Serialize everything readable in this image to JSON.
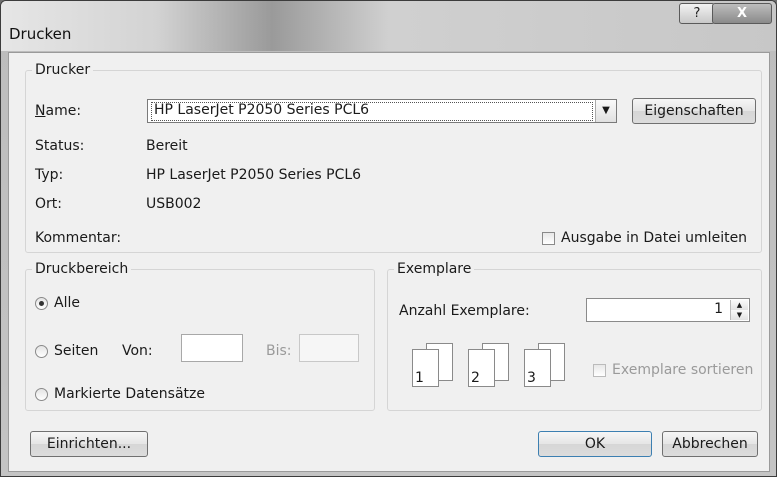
{
  "window": {
    "title": "Drucken",
    "help_label": "?",
    "close_label": "X"
  },
  "printer": {
    "legend": "Drucker",
    "name_label": "Name:",
    "name_value": "HP LaserJet P2050 Series PCL6",
    "properties_button": "Eigenschaften",
    "status_label": "Status:",
    "status_value": "Bereit",
    "type_label": "Typ:",
    "type_value": "HP LaserJet P2050 Series PCL6",
    "location_label": "Ort:",
    "location_value": "USB002",
    "comment_label": "Kommentar:",
    "print_to_file_label": "Ausgabe in Datei umleiten",
    "print_to_file_checked": false
  },
  "range": {
    "legend": "Druckbereich",
    "all_label": "Alle",
    "pages_label": "Seiten",
    "from_label": "Von:",
    "to_label": "Bis:",
    "selection_label": "Markierte Datensätze",
    "selected": "all"
  },
  "copies": {
    "legend": "Exemplare",
    "count_label": "Anzahl Exemplare:",
    "count_value": "1",
    "collate_label": "Exemplare sortieren",
    "collate_checked": false,
    "page_numbers": [
      "1",
      "1",
      "2",
      "2",
      "3",
      "3"
    ]
  },
  "footer": {
    "setup_button": "Einrichten...",
    "ok_button": "OK",
    "cancel_button": "Abbrechen"
  },
  "icons": {
    "dropdown": "chevron-down-icon",
    "spin_up": "spin-up-icon",
    "spin_down": "spin-down-icon"
  }
}
